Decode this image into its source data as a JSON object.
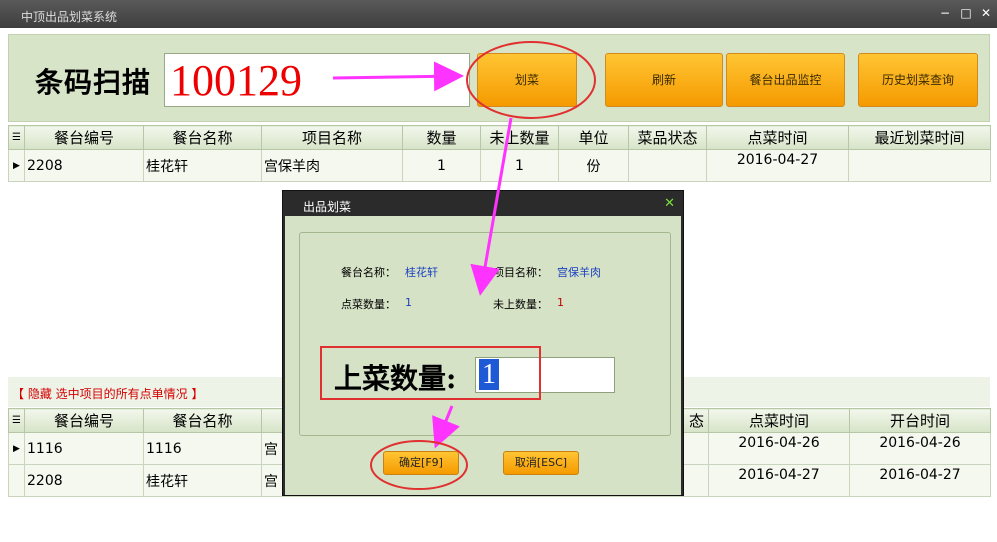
{
  "window": {
    "title": "中顶出品划菜系统",
    "minimize": "−",
    "maximize": "□",
    "close": "✕"
  },
  "scan": {
    "label": "条码扫描",
    "value": "100129"
  },
  "buttons": {
    "mark": "划菜",
    "refresh": "刷新",
    "monitor": "餐台出品监控",
    "history": "历史划菜查询"
  },
  "top_table": {
    "headers": [
      "餐台编号",
      "餐台名称",
      "项目名称",
      "数量",
      "未上数量",
      "单位",
      "菜品状态",
      "点菜时间",
      "最近划菜时间"
    ],
    "rows": [
      {
        "table_no": "2208",
        "table_name": "桂花轩",
        "item": "宫保羊肉",
        "qty": "1",
        "pending": "1",
        "unit": "份",
        "status": "",
        "order_time": "2016-04-27",
        "last_mark": ""
      }
    ]
  },
  "hide_note": "【 隐藏 选中项目的所有点单情况 】",
  "bottom_table": {
    "headers": [
      "餐台编号",
      "餐台名称",
      "",
      "态",
      "点菜时间",
      "开台时间"
    ],
    "rows": [
      {
        "table_no": "1116",
        "table_name": "1116",
        "item": "宫",
        "order_time": "2016-04-26",
        "open_time": "2016-04-26"
      },
      {
        "table_no": "2208",
        "table_name": "桂花轩",
        "item": "宫",
        "order_time": "2016-04-27",
        "open_time": "2016-04-27"
      }
    ]
  },
  "dialog": {
    "title": "出品划菜",
    "close": "✕",
    "table_name_label": "餐台名称：",
    "table_name": "桂花轩",
    "item_label": "项目名称：",
    "item": "宫保羊肉",
    "order_qty_label": "点菜数量：",
    "order_qty": "1",
    "pending_label": "未上数量：",
    "pending": "1",
    "serve_qty_label": "上菜数量:",
    "serve_qty": "1",
    "ok": "确定[F9]",
    "cancel": "取消[ESC]"
  },
  "icons": {
    "grid_header": "list-icon",
    "row_pointer": "row-pointer-icon"
  },
  "colors": {
    "accent_orange": "#f5a300",
    "panel_green": "#d7e4c8",
    "annotation_magenta": "#ff33ff",
    "annotation_red": "#e03030",
    "scan_red": "#e00000"
  }
}
